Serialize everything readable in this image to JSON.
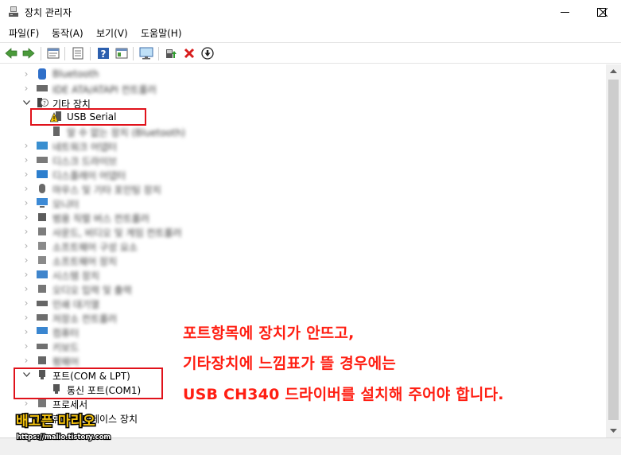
{
  "window": {
    "title": "장치 관리자",
    "icons": {
      "app": "device-manager-icon",
      "minimize": "minimize-icon",
      "maximize": "maximize-icon",
      "close": "close-icon"
    }
  },
  "menu": [
    "파일(F)",
    "동작(A)",
    "보기(V)",
    "도움말(H)"
  ],
  "toolbar": [
    "back-arrow-icon",
    "forward-arrow-icon",
    "properties-sheet-icon",
    "list-view-icon",
    "help-icon",
    "action-view-icon",
    "monitor-scan-icon",
    "update-driver-icon",
    "uninstall-x-icon",
    "disable-down-icon"
  ],
  "tree": {
    "row1": "Bluetooth",
    "row2": "IDE ATA/ATAPI 컨트롤러",
    "other_devices": "기타 장치",
    "usb_serial": "USB Serial",
    "row5": "알 수 없는 장치 (Bluetooth)",
    "row6": "네트워크 어댑터",
    "row7": "디스크 드라이브",
    "row8": "디스플레이 어댑터",
    "row9": "마우스 및 기타 포인팅 장치",
    "row10": "모니터",
    "row11": "범용 직렬 버스 컨트롤러",
    "row12": "사운드, 비디오 및 게임 컨트롤러",
    "row13": "소프트웨어 구성 요소",
    "row14": "소프트웨어 장치",
    "row15": "시스템 장치",
    "row16": "오디오 입력 및 출력",
    "row17": "인쇄 대기열",
    "row18": "저장소 컨트롤러",
    "row19": "컴퓨터",
    "row20": "키보드",
    "row21": "펌웨어",
    "ports": "포트(COM & LPT)",
    "com1": "통신 포트(COM1)",
    "processor": "프로세서",
    "hid": "휴먼 인터페이스 장치"
  },
  "annotation": {
    "line1": "포트항목에 장치가 안뜨고,",
    "line2": "기타장치에 느낌표가 뜰 경우에는",
    "line3": "USB CH340 드라이버를 설치해 주어야 합니다.",
    "color": "#ff1e12"
  },
  "watermark": {
    "title": "배고픈 마리오",
    "url": "https://malio.tistory.com"
  },
  "colors": {
    "highlight_box": "#e0121b",
    "warning": "#f5c400"
  }
}
